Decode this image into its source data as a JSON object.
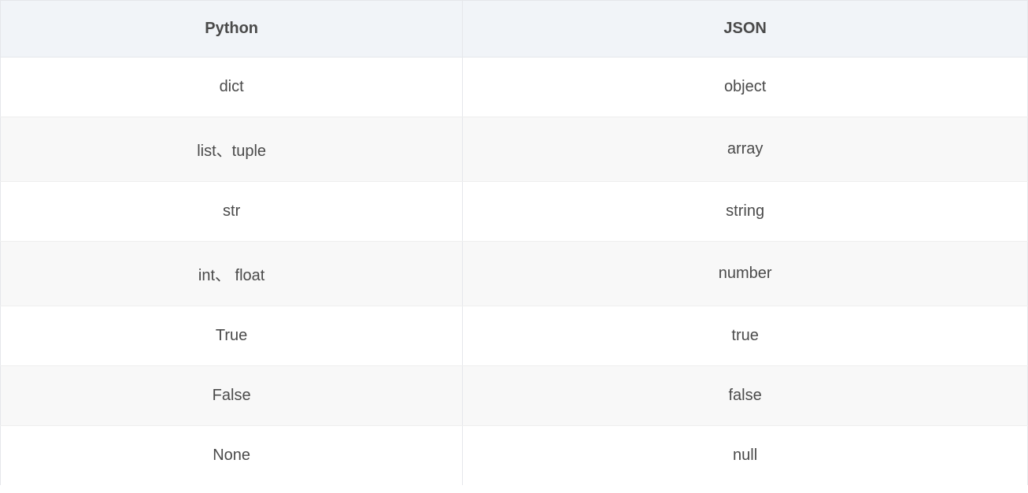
{
  "table": {
    "headers": {
      "python": "Python",
      "json": "JSON"
    },
    "rows": [
      {
        "python": "dict",
        "json": "object"
      },
      {
        "python": "list、tuple",
        "json": "array"
      },
      {
        "python": "str",
        "json": "string"
      },
      {
        "python": "int、 float",
        "json": "number"
      },
      {
        "python": "True",
        "json": "true"
      },
      {
        "python": "False",
        "json": "false"
      },
      {
        "python": "None",
        "json": "null"
      }
    ]
  }
}
